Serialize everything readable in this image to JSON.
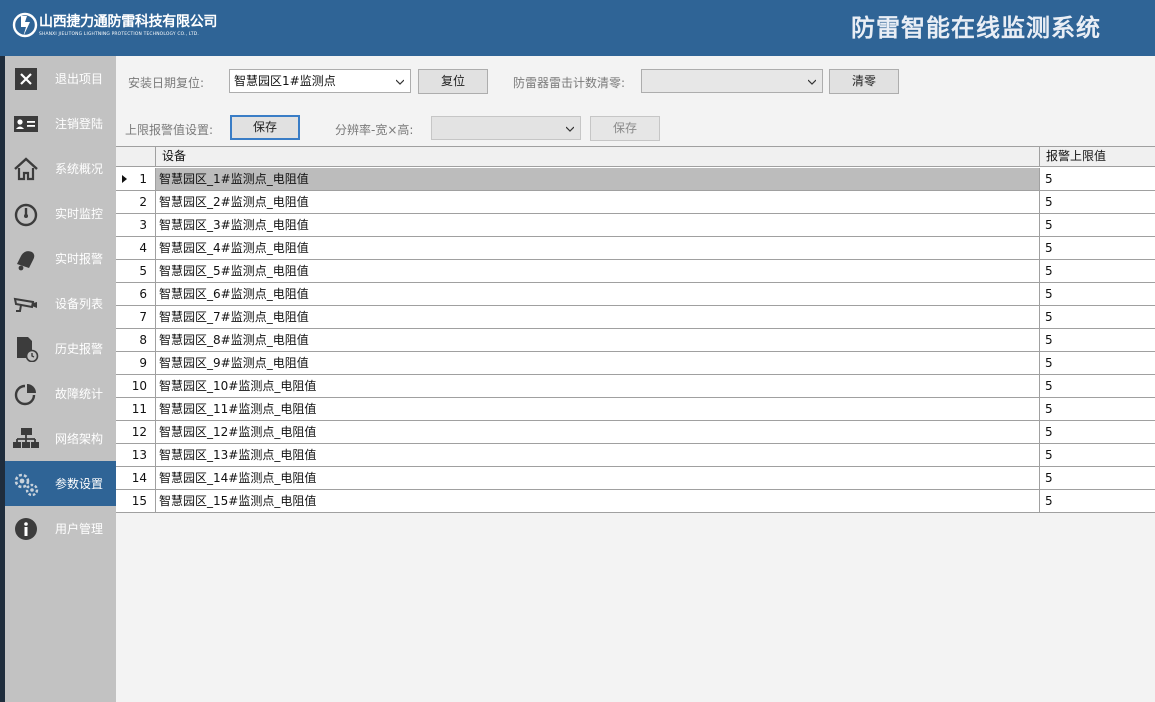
{
  "header": {
    "company_cn": "山西捷力通防雷科技有限公司",
    "company_en": "SHANXI JIELITONG LIGHTNING PROTECTION TECHNOLOGY CO., LTD.",
    "system_title": "防雷智能在线监测系统"
  },
  "sidebar": {
    "active_index": 9,
    "items": [
      {
        "label": "退出项目",
        "icon": "exit-icon"
      },
      {
        "label": "注销登陆",
        "icon": "id-card-icon"
      },
      {
        "label": "系统概况",
        "icon": "home-icon"
      },
      {
        "label": "实时监控",
        "icon": "gauge-icon"
      },
      {
        "label": "实时报警",
        "icon": "bell-icon"
      },
      {
        "label": "设备列表",
        "icon": "camera-icon"
      },
      {
        "label": "历史报警",
        "icon": "history-doc-icon"
      },
      {
        "label": "故障统计",
        "icon": "pie-chart-icon"
      },
      {
        "label": "网络架构",
        "icon": "network-icon"
      },
      {
        "label": "参数设置",
        "icon": "gears-icon"
      },
      {
        "label": "用户管理",
        "icon": "info-icon"
      }
    ]
  },
  "toolbar": {
    "install_date_label": "安装日期复位:",
    "install_date_value": "智慧园区1#监测点",
    "reset_button": "复位",
    "strike_count_label": "防雷器雷击计数清零:",
    "strike_count_value": "",
    "clear_button": "清零",
    "upper_limit_label": "上限报警值设置:",
    "save_button": "保存",
    "resolution_label": "分辨率-宽×高:",
    "resolution_value": "",
    "resolution_save_button": "保存"
  },
  "grid": {
    "columns": [
      "设备",
      "报警上限值"
    ],
    "selected_row": 0,
    "rows": [
      {
        "no": "1",
        "device": "智慧园区_1#监测点_电阻值",
        "limit": "5"
      },
      {
        "no": "2",
        "device": "智慧园区_2#监测点_电阻值",
        "limit": "5"
      },
      {
        "no": "3",
        "device": "智慧园区_3#监测点_电阻值",
        "limit": "5"
      },
      {
        "no": "4",
        "device": "智慧园区_4#监测点_电阻值",
        "limit": "5"
      },
      {
        "no": "5",
        "device": "智慧园区_5#监测点_电阻值",
        "limit": "5"
      },
      {
        "no": "6",
        "device": "智慧园区_6#监测点_电阻值",
        "limit": "5"
      },
      {
        "no": "7",
        "device": "智慧园区_7#监测点_电阻值",
        "limit": "5"
      },
      {
        "no": "8",
        "device": "智慧园区_8#监测点_电阻值",
        "limit": "5"
      },
      {
        "no": "9",
        "device": "智慧园区_9#监测点_电阻值",
        "limit": "5"
      },
      {
        "no": "10",
        "device": "智慧园区_10#监测点_电阻值",
        "limit": "5"
      },
      {
        "no": "11",
        "device": "智慧园区_11#监测点_电阻值",
        "limit": "5"
      },
      {
        "no": "12",
        "device": "智慧园区_12#监测点_电阻值",
        "limit": "5"
      },
      {
        "no": "13",
        "device": "智慧园区_13#监测点_电阻值",
        "limit": "5"
      },
      {
        "no": "14",
        "device": "智慧园区_14#监测点_电阻值",
        "limit": "5"
      },
      {
        "no": "15",
        "device": "智慧园区_15#监测点_电阻值",
        "limit": "5"
      }
    ]
  },
  "colors": {
    "header_bg": "#2f6496",
    "sidebar_bg": "#c2c2c2",
    "sidebar_active": "#2f6496",
    "selected_row": "#bcbcbc"
  }
}
